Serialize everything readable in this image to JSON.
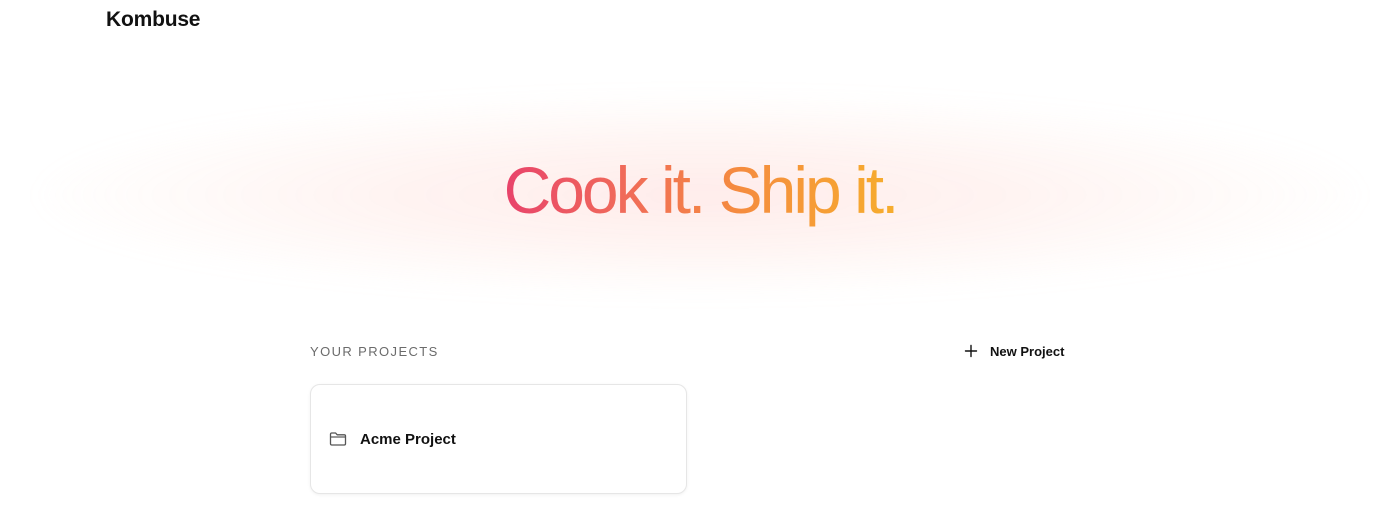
{
  "header": {
    "brand": "Kombuse"
  },
  "hero": {
    "title": "Cook it. Ship it.",
    "gradient_colors": [
      "#e8436b",
      "#f06a5a",
      "#f58c3f",
      "#f6ad2d"
    ]
  },
  "projects": {
    "section_label": "YOUR PROJECTS",
    "new_project_label": "New Project",
    "new_project_icon": "plus-icon",
    "items": [
      {
        "name": "Acme Project",
        "icon": "folder-icon"
      }
    ]
  }
}
